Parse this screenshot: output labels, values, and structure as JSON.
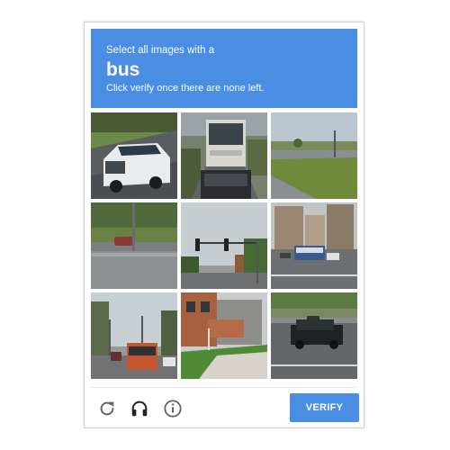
{
  "challenge": {
    "instruction": "Select all images with a",
    "keyword": "bus",
    "subtext": "Click verify once there are none left."
  },
  "tiles": [
    {
      "content": "white minivan on road"
    },
    {
      "content": "bus on road"
    },
    {
      "content": "grass and road"
    },
    {
      "content": "highway with wall"
    },
    {
      "content": "traffic light"
    },
    {
      "content": "buildings with bus"
    },
    {
      "content": "street with bus"
    },
    {
      "content": "house and lawn"
    },
    {
      "content": "black SUV on road"
    }
  ],
  "footer": {
    "reload_icon": "reload-icon",
    "audio_icon": "headphones-icon",
    "info_icon": "info-icon",
    "verify_label": "VERIFY"
  },
  "colors": {
    "accent": "#4a8ee3",
    "border": "#d3d3d3"
  }
}
